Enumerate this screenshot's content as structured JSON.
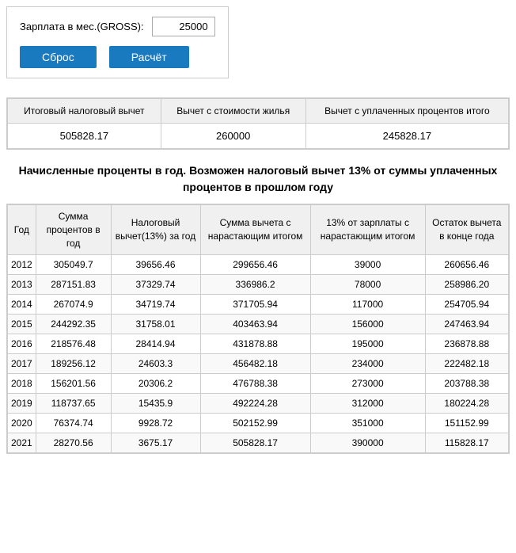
{
  "topSection": {
    "salaryLabel": "Зарплата в мес.(GROSS):",
    "salaryValue": "25000",
    "resetLabel": "Сброс",
    "calcLabel": "Расчёт"
  },
  "summaryTable": {
    "headers": [
      "Итоговый налоговый вычет",
      "Вычет с стоимости жилья",
      "Вычет с уплаченных процентов итого"
    ],
    "values": [
      "505828.17",
      "260000",
      "245828.17"
    ]
  },
  "noticeText": "Начисленные проценты в год. Возможен налоговый вычет 13% от суммы уплаченных процентов в прошлом году",
  "mainTable": {
    "headers": [
      "Год",
      "Сумма процентов в год",
      "Налоговый вычет(13%) за год",
      "Сумма вычета с нарастающим итогом",
      "13% от зарплаты с нарастающим итогом",
      "Остаток вычета в конце года"
    ],
    "rows": [
      [
        "2012",
        "305049.7",
        "39656.46",
        "299656.46",
        "39000",
        "260656.46"
      ],
      [
        "2013",
        "287151.83",
        "37329.74",
        "336986.2",
        "78000",
        "258986.20"
      ],
      [
        "2014",
        "267074.9",
        "34719.74",
        "371705.94",
        "117000",
        "254705.94"
      ],
      [
        "2015",
        "244292.35",
        "31758.01",
        "403463.94",
        "156000",
        "247463.94"
      ],
      [
        "2016",
        "218576.48",
        "28414.94",
        "431878.88",
        "195000",
        "236878.88"
      ],
      [
        "2017",
        "189256.12",
        "24603.3",
        "456482.18",
        "234000",
        "222482.18"
      ],
      [
        "2018",
        "156201.56",
        "20306.2",
        "476788.38",
        "273000",
        "203788.38"
      ],
      [
        "2019",
        "118737.65",
        "15435.9",
        "492224.28",
        "312000",
        "180224.28"
      ],
      [
        "2020",
        "76374.74",
        "9928.72",
        "502152.99",
        "351000",
        "151152.99"
      ],
      [
        "2021",
        "28270.56",
        "3675.17",
        "505828.17",
        "390000",
        "115828.17"
      ]
    ]
  }
}
